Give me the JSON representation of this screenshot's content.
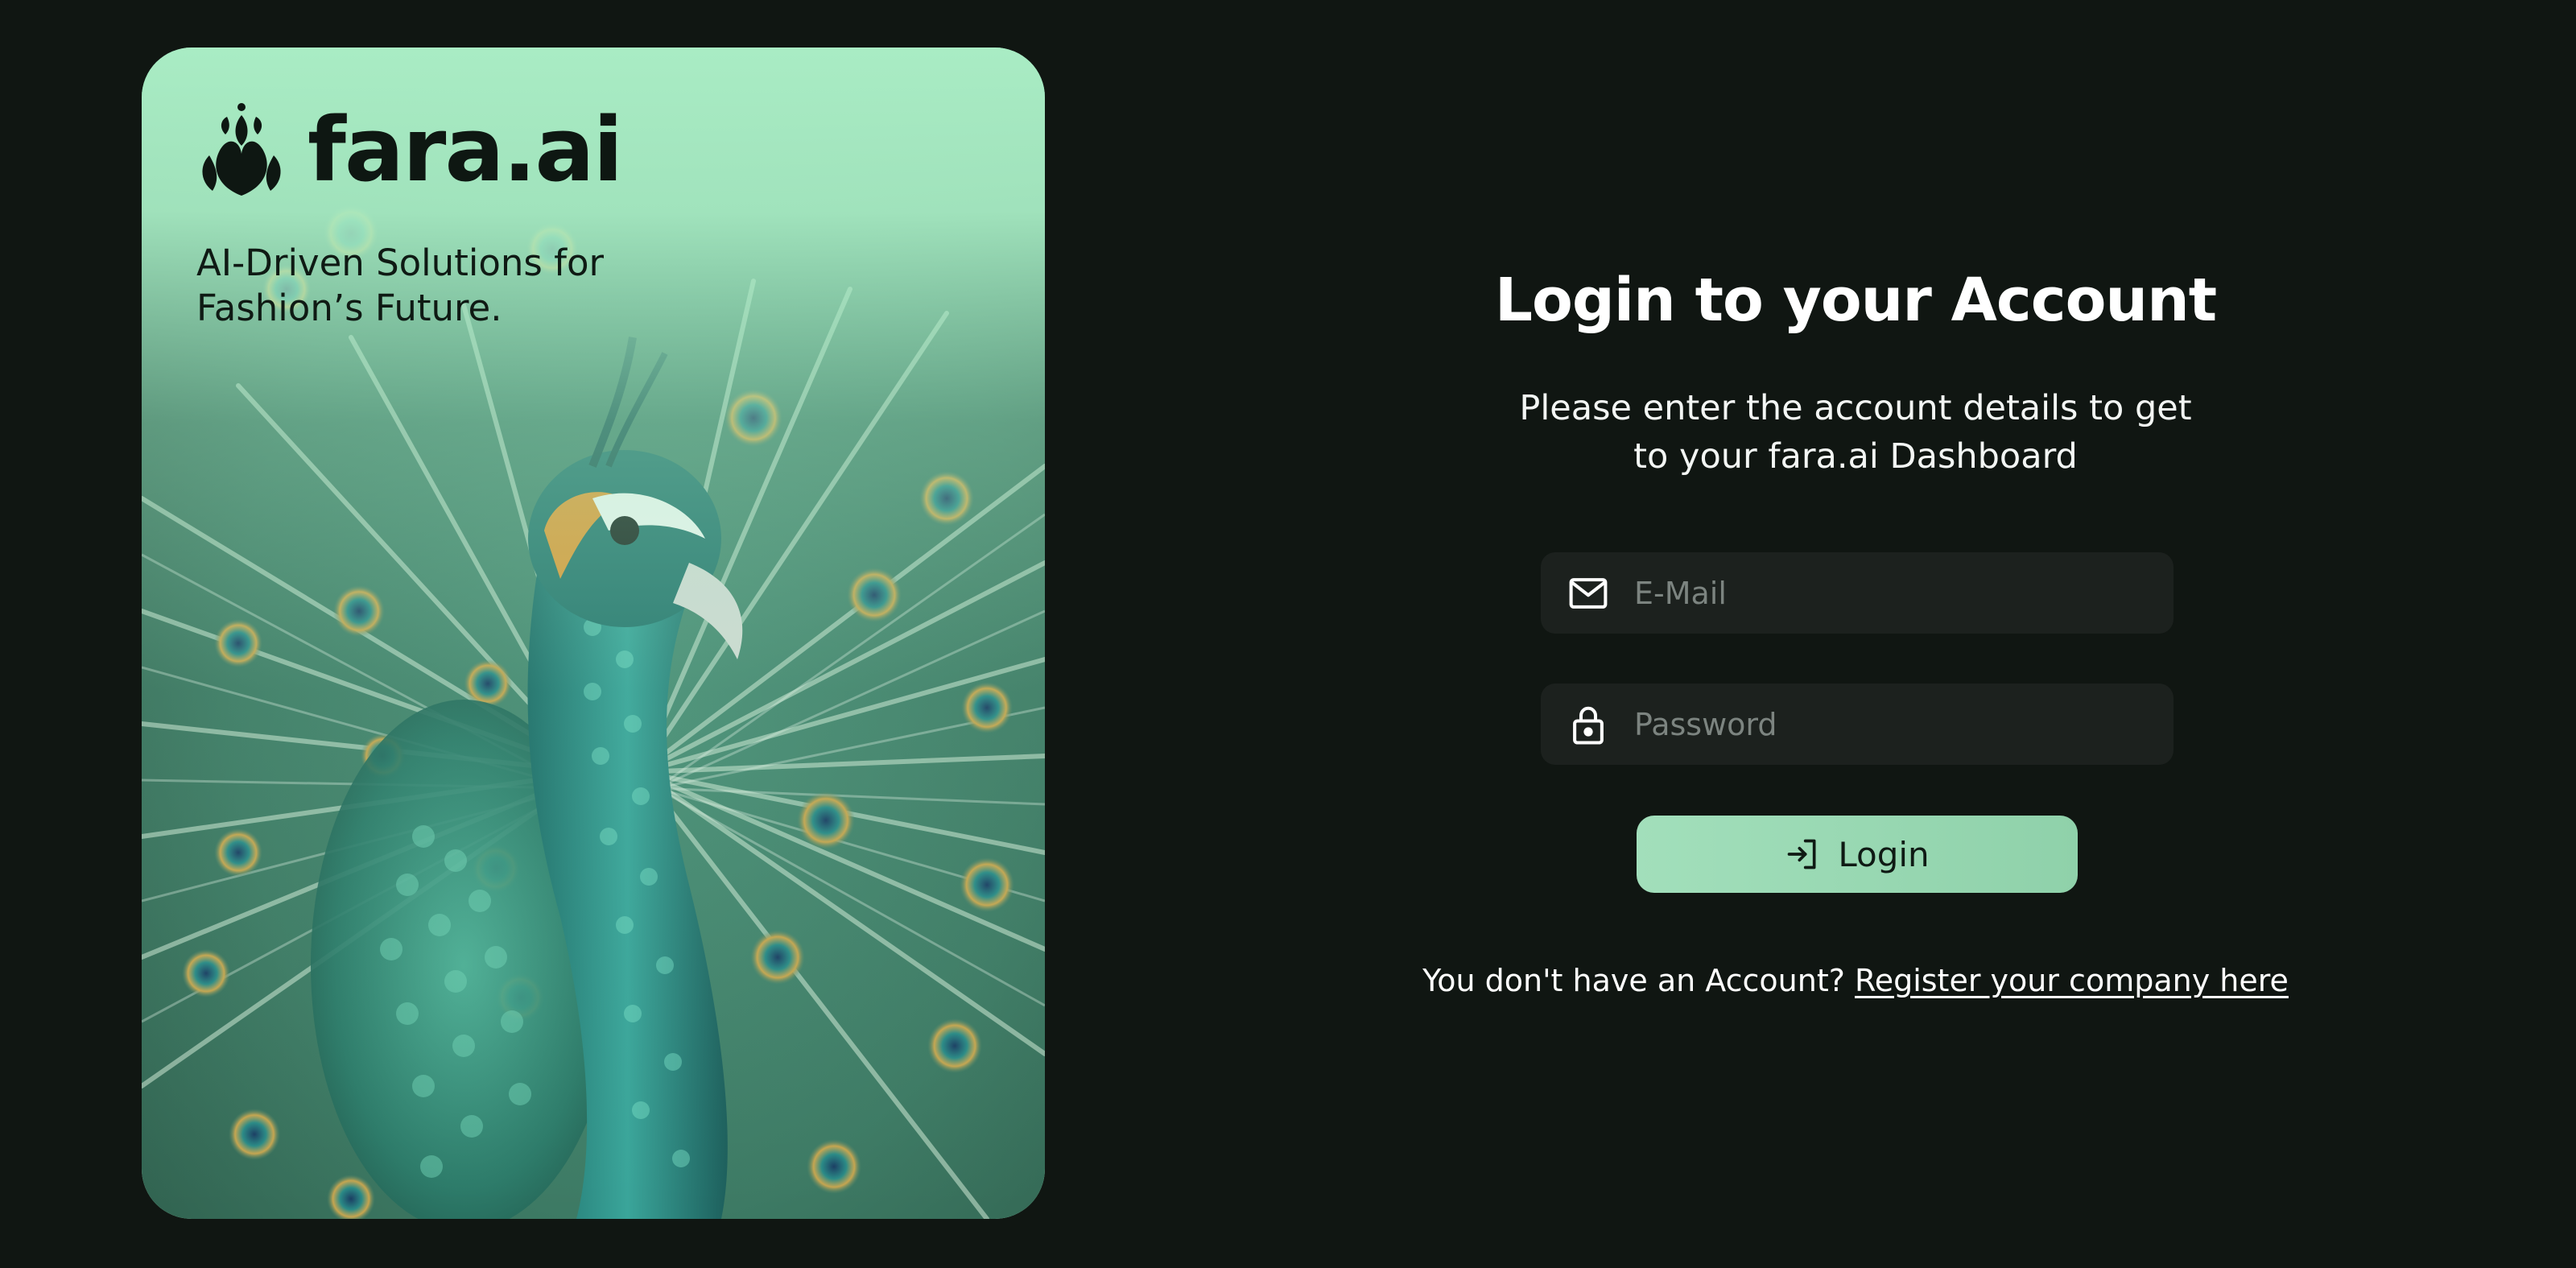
{
  "hero": {
    "brand_name": "fara.ai",
    "tagline_line1": "AI-Driven Solutions for",
    "tagline_line2": "Fashion’s Future.",
    "background_color": "#a9ecc4",
    "image": "peacock-photo"
  },
  "login": {
    "title": "Login to your Account",
    "subtitle_line1": "Please enter the account details to get",
    "subtitle_line2": "to your fara.ai Dashboard",
    "email": {
      "placeholder": "E-Mail",
      "value": "",
      "icon": "mail-icon"
    },
    "password": {
      "placeholder": "Password",
      "value": "",
      "icon": "lock-icon"
    },
    "submit": {
      "label": "Login",
      "icon": "login-arrow-icon",
      "color": "#97d7b1"
    },
    "register_prompt": "You don't have an Account?",
    "register_link": "Register your company here"
  },
  "colors": {
    "page_background": "#101612",
    "field_background": "#1c211e",
    "text_primary": "#ffffff"
  }
}
